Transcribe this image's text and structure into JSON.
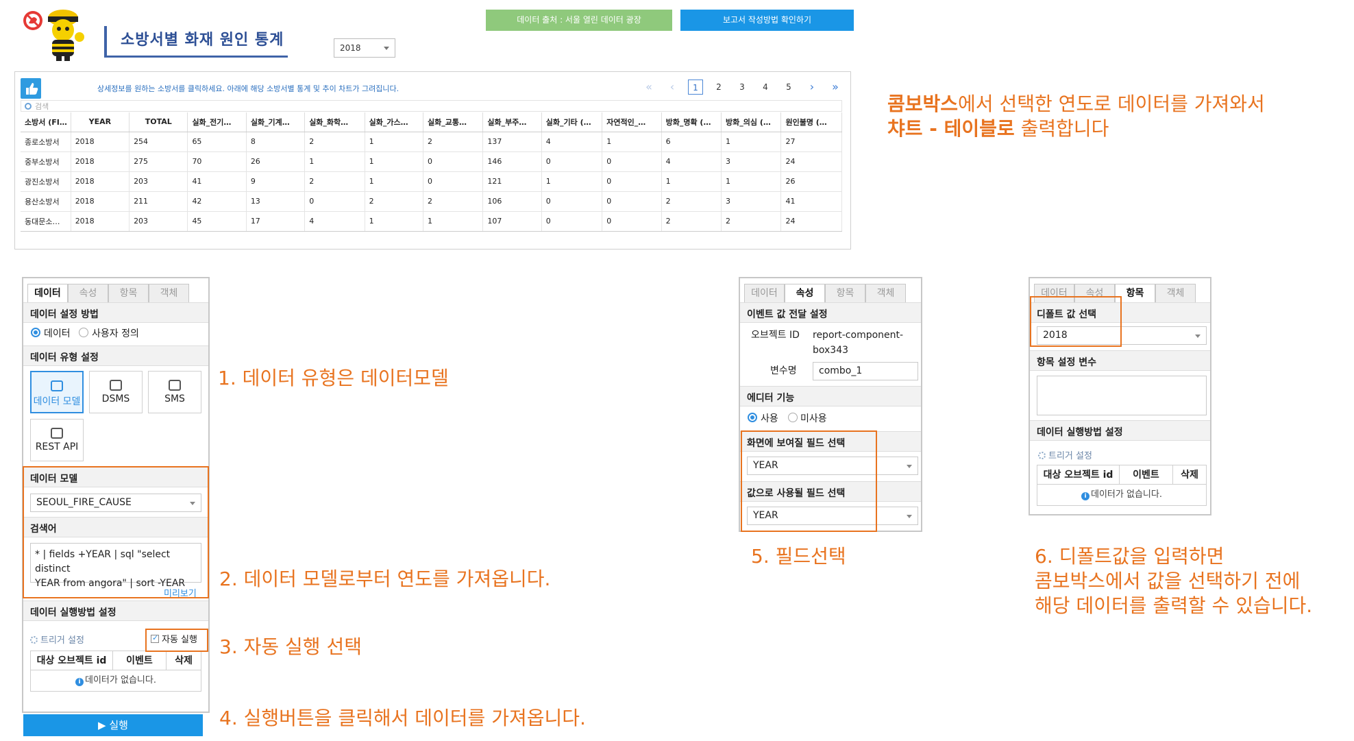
{
  "header": {
    "title": "소방서별 화재 원인 통계",
    "year_select": "2018",
    "source_button": "데이터 출처 : 서울 열린 데이터 광장",
    "report_button": "보고서 작성방법 확인하기"
  },
  "table_panel": {
    "info_text": "상세정보를 원하는 소방서를 클릭하세요. 아래에 해당 소방서별 통계 및 추이 차트가 그려집니다.",
    "search_placeholder": "검색",
    "pager": {
      "first": "«",
      "prev": "‹",
      "pages": [
        "1",
        "2",
        "3",
        "4",
        "5"
      ],
      "current": "1",
      "next": "›",
      "last": "»"
    },
    "columns": [
      "소방서 (FI…",
      "YEAR",
      "TOTAL",
      "실화_전기…",
      "실화_기계…",
      "실화_화학…",
      "실화_가스…",
      "실화_교통…",
      "실화_부주…",
      "실화_기타 (…",
      "자연적인_…",
      "방화_명확 (…",
      "방화_의심 (…",
      "원인불명 (…"
    ],
    "rows": [
      [
        "종로소방서",
        "2018",
        "254",
        "65",
        "8",
        "2",
        "1",
        "2",
        "137",
        "4",
        "1",
        "6",
        "1",
        "27"
      ],
      [
        "중부소방서",
        "2018",
        "275",
        "70",
        "26",
        "1",
        "1",
        "0",
        "146",
        "0",
        "0",
        "4",
        "3",
        "24"
      ],
      [
        "광진소방서",
        "2018",
        "203",
        "41",
        "9",
        "2",
        "1",
        "0",
        "121",
        "1",
        "0",
        "1",
        "1",
        "26"
      ],
      [
        "용산소방서",
        "2018",
        "211",
        "42",
        "13",
        "0",
        "2",
        "2",
        "106",
        "0",
        "0",
        "2",
        "3",
        "41"
      ],
      [
        "동대문소…",
        "2018",
        "203",
        "45",
        "17",
        "4",
        "1",
        "1",
        "107",
        "0",
        "0",
        "2",
        "2",
        "24"
      ]
    ]
  },
  "note": {
    "line1_bold": "콤보박스",
    "line1_rest": "에서 선택한 연도로 데이터를 가져와서",
    "line2_bold": "챠트 - 테이블로",
    "line2_rest": " 출력합니다"
  },
  "data_panel": {
    "tabs": [
      "데이터",
      "속성",
      "항목",
      "객체"
    ],
    "sec_method": "데이터 설정 방법",
    "radio_data": "데이터",
    "radio_custom": "사용자 정의",
    "sec_type": "데이터 유형 설정",
    "tiles": [
      "데이터 모델",
      "DSMS",
      "SMS",
      "REST API"
    ],
    "sec_model": "데이터 모델",
    "model_value": "SEOUL_FIRE_CAUSE",
    "sec_search": "검색어",
    "search_line1": "* | fields +YEAR | sql \"select distinct",
    "search_line2": "YEAR from angora\" | sort -YEAR",
    "preview": "미리보기",
    "sec_exec": "데이터 실행방법 설정",
    "trigger": "트리거 설정",
    "auto_run": "자동 실행",
    "table_headers": [
      "대상 오브젝트 id",
      "이벤트",
      "삭제"
    ],
    "empty": "데이터가 없습니다.",
    "run_button": "▶ 실행"
  },
  "prop_panel": {
    "tabs": [
      "데이터",
      "속성",
      "항목",
      "객체"
    ],
    "sec_event": "이벤트 값 전달 설정",
    "object_id_label": "오브젝트 ID",
    "object_id_line1": "report-component-",
    "object_id_line2": "box343",
    "var_label": "변수명",
    "var_value": "combo_1",
    "sec_editor": "에디터 기능",
    "use": "사용",
    "unuse": "미사용",
    "sec_display": "화면에 보여질 필드 선택",
    "display_value": "YEAR",
    "sec_value": "값으로 사용될 필드 선택",
    "value_value": "YEAR"
  },
  "item_panel": {
    "tabs": [
      "데이터",
      "속성",
      "항목",
      "객체"
    ],
    "sec_default": "디폴트 값 선택",
    "default_value": "2018",
    "sec_itemvar": "항목 설정 변수",
    "sec_exec": "데이터 실행방법 설정",
    "trigger": "트리거 설정",
    "table_headers": [
      "대상 오브젝트 id",
      "이벤트",
      "삭제"
    ],
    "empty": "데이터가 없습니다."
  },
  "steps": {
    "s1": "1. 데이터 유형은 데이터모델",
    "s2": "2. 데이터 모델로부터 연도를 가져옵니다.",
    "s3": "3. 자동 실행 선택",
    "s4": "4. 실행버튼을 클릭해서 데이터를 가져옵니다.",
    "s5": "5. 필드선택",
    "s6_1": "6. 디폴트값을 입력하면",
    "s6_2": "콤보박스에서 값을 선택하기 전에",
    "s6_3": "해당 데이터를 출력할 수 있습니다."
  },
  "colors": {
    "accent": "#e8731f",
    "blue": "#1a96e6",
    "green": "#8fc97c",
    "title": "#2d4f95"
  }
}
